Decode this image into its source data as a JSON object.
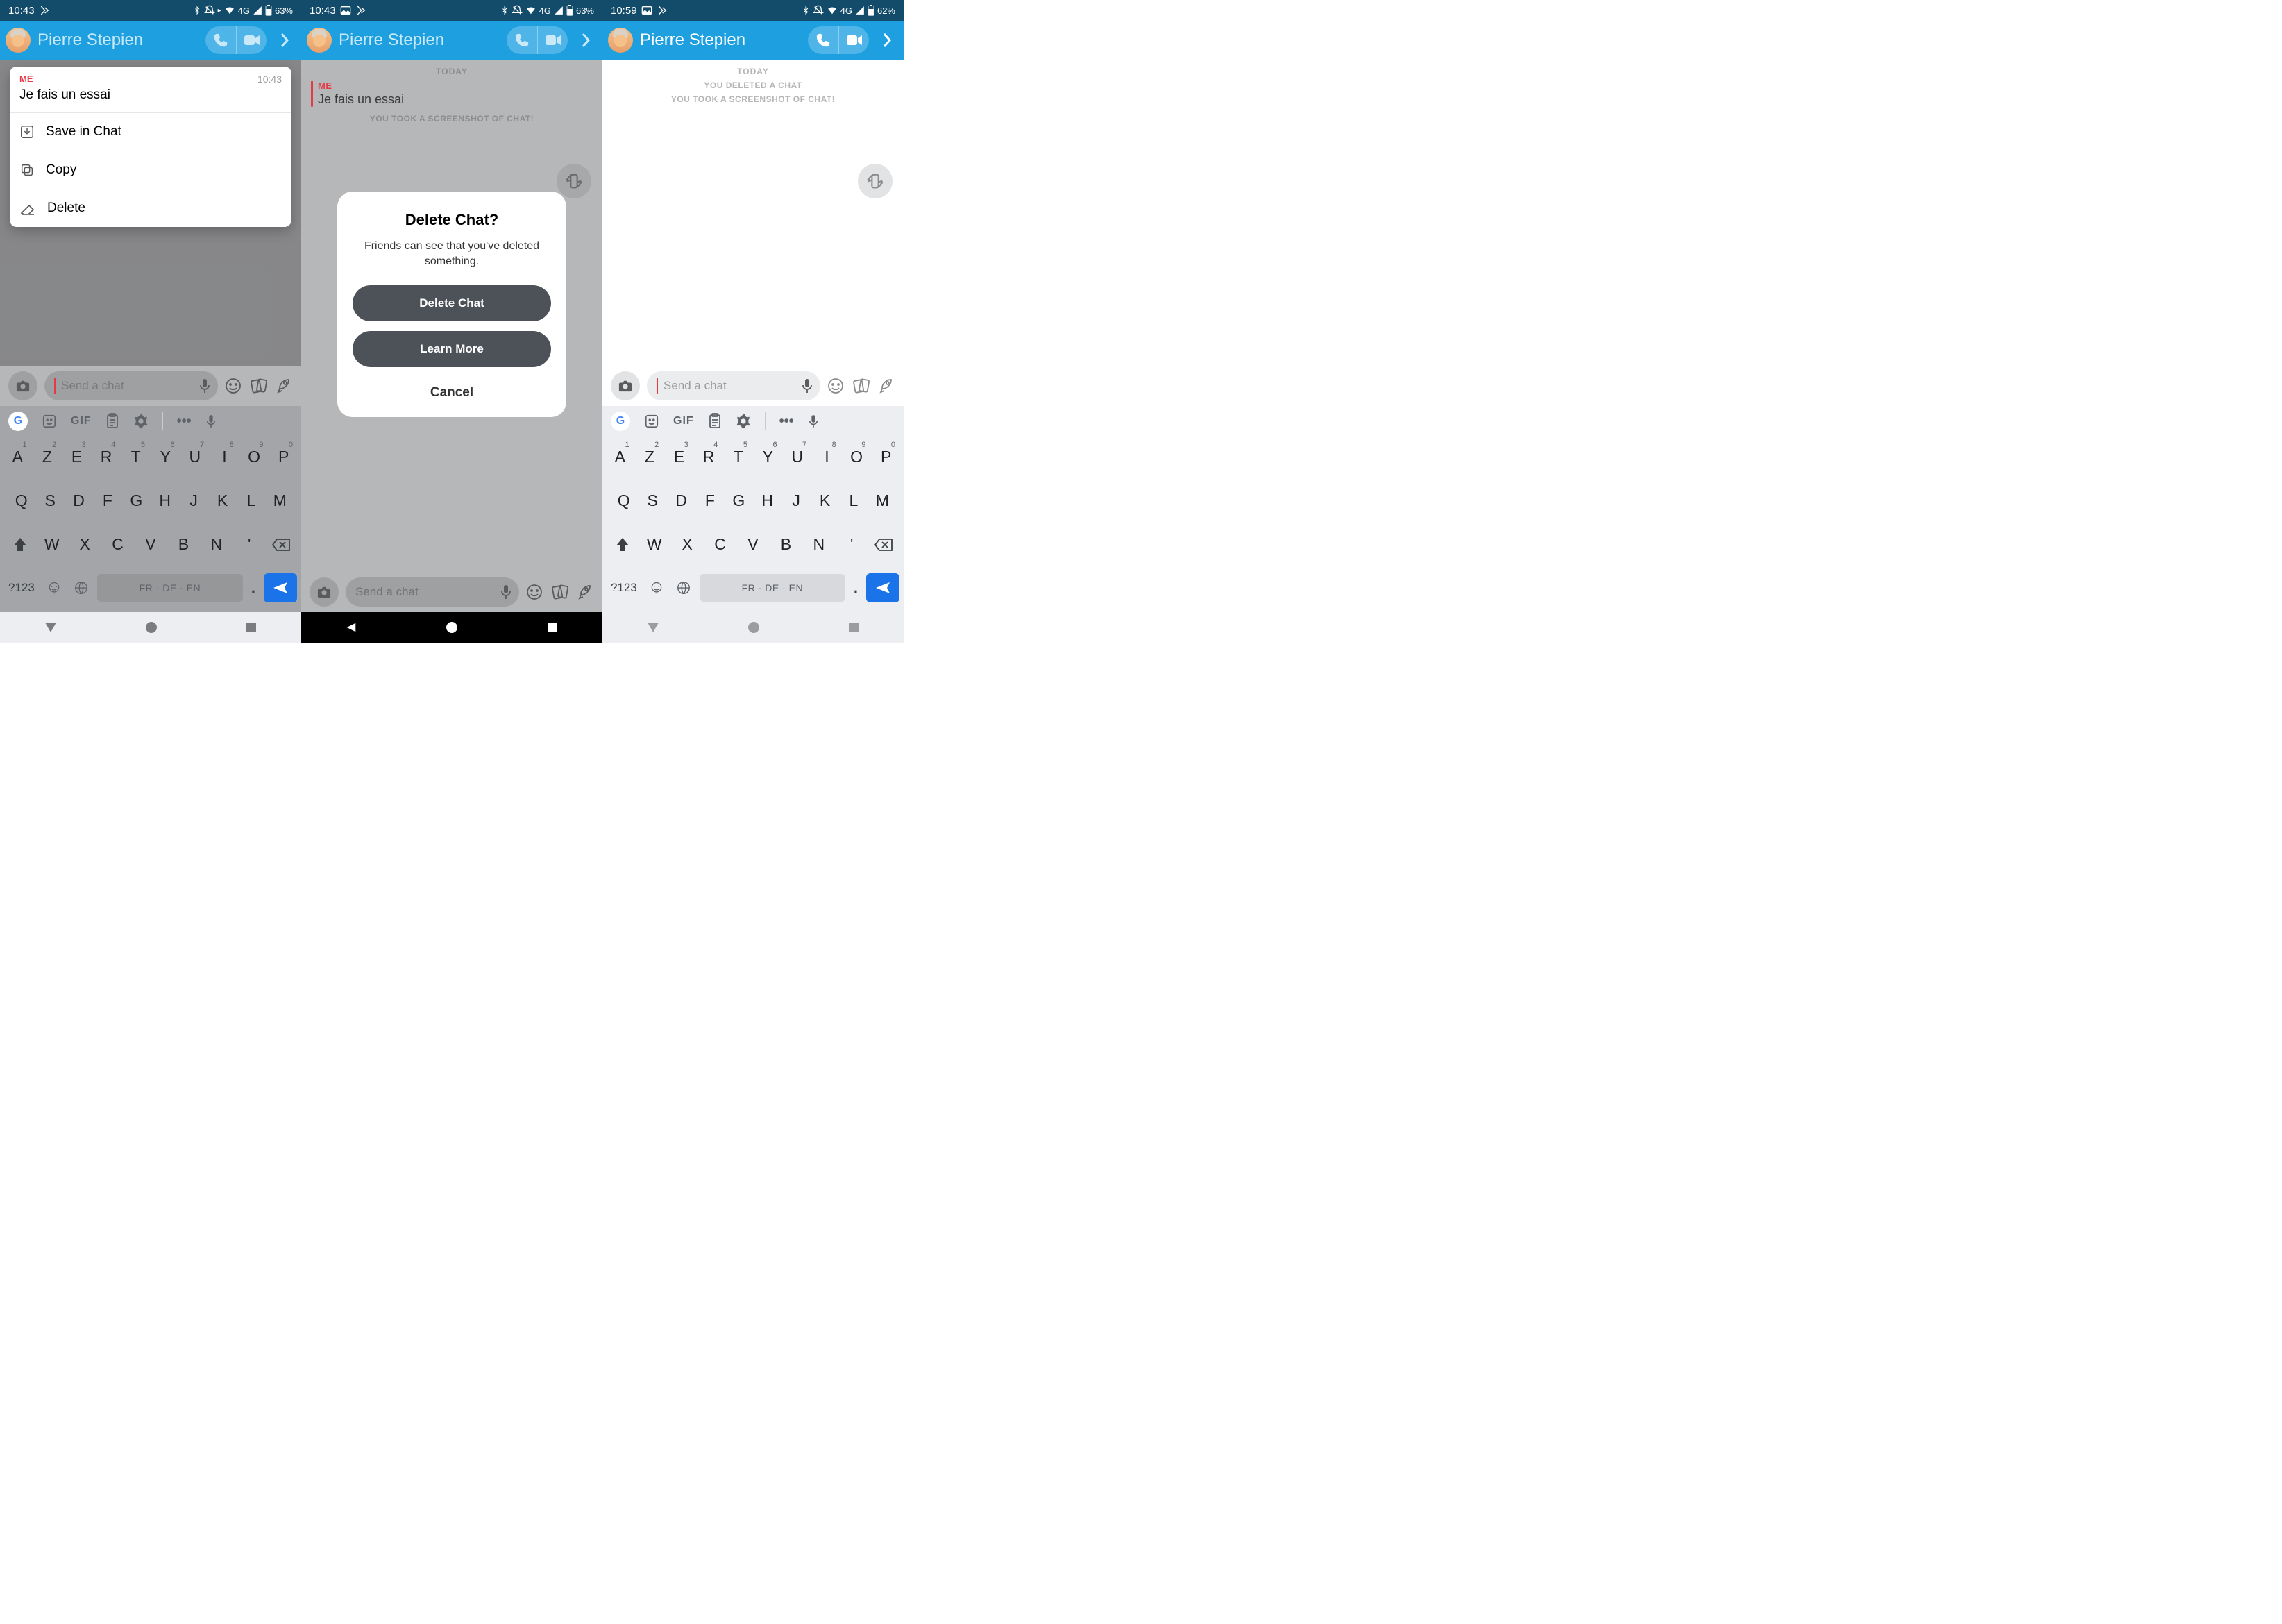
{
  "status": {
    "time1": "10:43",
    "time2": "10:43",
    "time3": "10:59",
    "net": "4G",
    "batt1": "63%",
    "batt2": "63%",
    "batt3": "62%"
  },
  "header": {
    "contact": "Pierre Stepien"
  },
  "chat": {
    "today": "TODAY",
    "me": "ME",
    "msg": "Je fais un essai",
    "screenshot_notice": "YOU TOOK A SCREENSHOT OF CHAT!",
    "deleted_notice": "YOU DELETED A CHAT"
  },
  "ctx": {
    "time": "10:43",
    "items": [
      "Save in Chat",
      "Copy",
      "Delete"
    ]
  },
  "modal": {
    "title": "Delete Chat?",
    "body": "Friends can see that you've deleted something.",
    "primary": "Delete Chat",
    "secondary": "Learn More",
    "cancel": "Cancel"
  },
  "composer": {
    "placeholder": "Send a chat"
  },
  "kb": {
    "gif": "GIF",
    "row1": [
      [
        "a",
        "1"
      ],
      [
        "z",
        "2"
      ],
      [
        "e",
        "3"
      ],
      [
        "r",
        "4"
      ],
      [
        "t",
        "5"
      ],
      [
        "y",
        "6"
      ],
      [
        "u",
        "7"
      ],
      [
        "i",
        "8"
      ],
      [
        "o",
        "9"
      ],
      [
        "p",
        "0"
      ]
    ],
    "row1_upper": [
      "A",
      "Z",
      "E",
      "R",
      "T",
      "Y",
      "U",
      "I",
      "O",
      "P"
    ],
    "row2": [
      "Q",
      "S",
      "D",
      "F",
      "G",
      "H",
      "J",
      "K",
      "L",
      "M"
    ],
    "row3": [
      "W",
      "X",
      "C",
      "V",
      "B",
      "N",
      "'"
    ],
    "sym": "?123",
    "space": "FR · DE · EN",
    "dot": "."
  }
}
